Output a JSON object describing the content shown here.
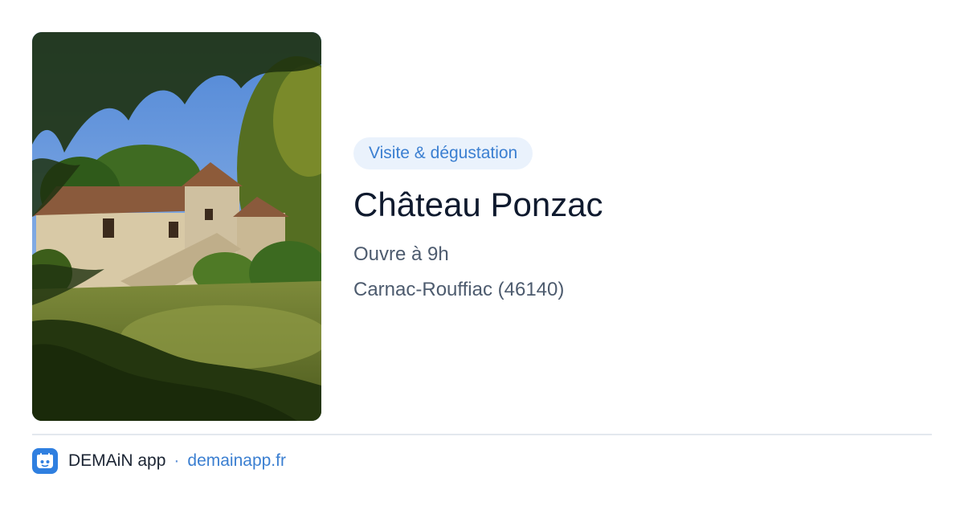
{
  "card": {
    "photo_alt": "Château Ponzac",
    "category": "Visite & dégustation",
    "title": "Château Ponzac",
    "hours": "Ouvre à 9h",
    "location": "Carnac-Rouffiac (46140)"
  },
  "footer": {
    "app_name": "DEMAiN app",
    "separator": "·",
    "site": "demainapp.fr"
  },
  "colors": {
    "accent": "#3b7fd1",
    "badge_bg": "#eaf2fc",
    "title": "#0f1a2e",
    "muted": "#4d5b6e"
  },
  "icons": {
    "app_logo": "demain-app-icon"
  }
}
